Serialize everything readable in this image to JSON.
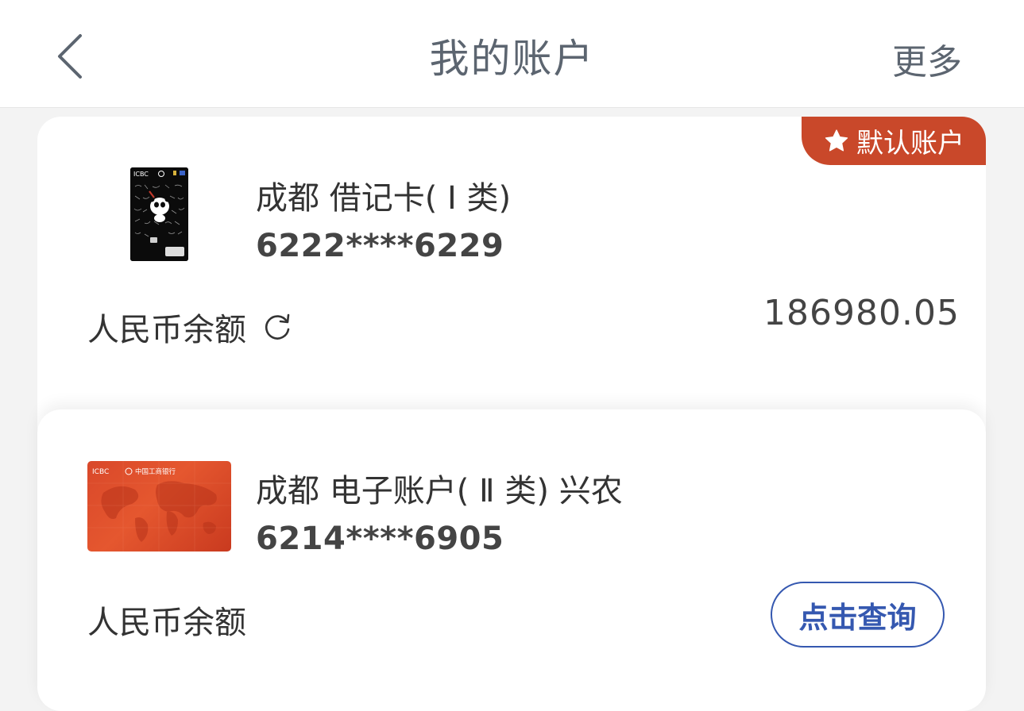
{
  "header": {
    "title": "我的账户",
    "more_label": "更多"
  },
  "accounts": [
    {
      "badge": "默认账户",
      "name": "成都 借记卡( Ⅰ 类)",
      "number": "6222****6229",
      "balance_label": "人民币余额",
      "balance_value": "186980.05",
      "card_brand": "ICBC"
    },
    {
      "name": "成都 电子账户( Ⅱ 类) 兴农",
      "number": "6214****6905",
      "balance_label": "人民币余额",
      "query_label": "点击查询",
      "card_brand": "ICBC",
      "card_bank": "中国工商银行"
    }
  ],
  "colors": {
    "badge": "#c9482a",
    "query_button": "#3558b0",
    "title_text": "#5c6570"
  },
  "icons": {
    "back": "chevron-left-icon",
    "star": "star-icon",
    "refresh": "refresh-icon"
  }
}
